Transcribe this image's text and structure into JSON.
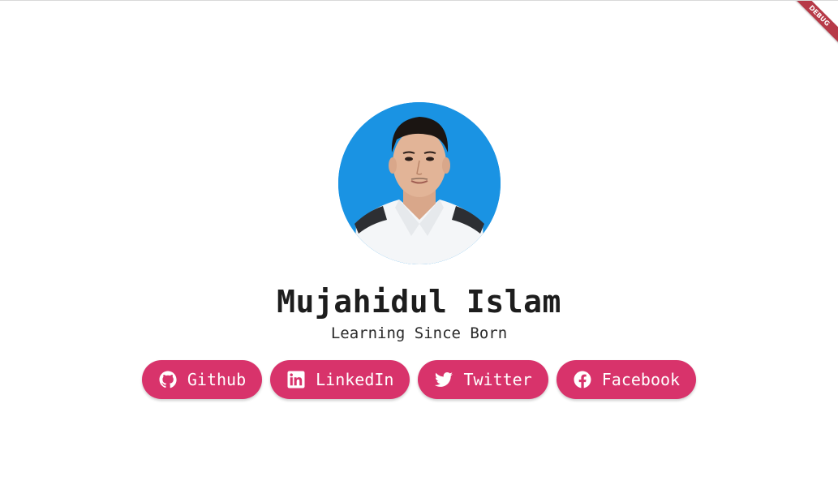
{
  "debug_banner": {
    "label": "DEBUG"
  },
  "profile": {
    "name": "Mujahidul Islam",
    "tagline": "Learning Since Born"
  },
  "links": [
    {
      "label": "Github",
      "icon": "github-icon"
    },
    {
      "label": "LinkedIn",
      "icon": "linkedin-icon"
    },
    {
      "label": "Twitter",
      "icon": "twitter-icon"
    },
    {
      "label": "Facebook",
      "icon": "facebook-icon"
    }
  ],
  "colors": {
    "accent": "#d8336b",
    "avatar_background": "#1a93e3",
    "text": "#1d1d1d",
    "debug_ribbon": "#b73a48"
  }
}
